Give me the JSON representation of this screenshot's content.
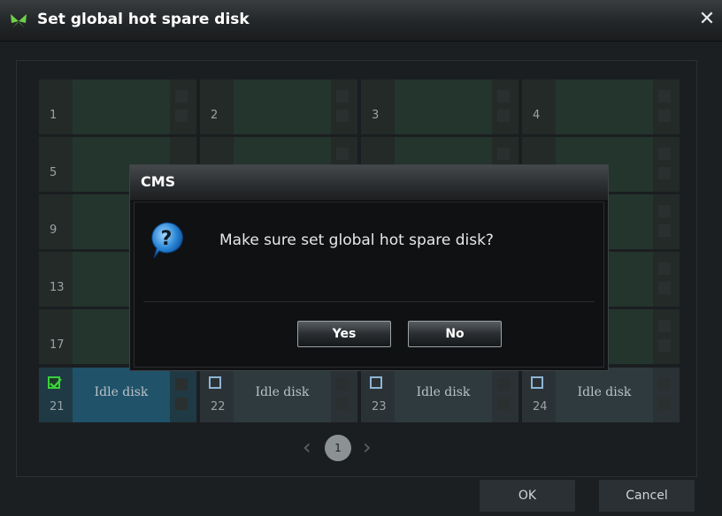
{
  "window": {
    "title": "Set global hot spare disk",
    "close_symbol": "✕"
  },
  "slots": [
    {
      "num": "1"
    },
    {
      "num": "2"
    },
    {
      "num": "3"
    },
    {
      "num": "4"
    },
    {
      "num": "5"
    },
    {
      "num": "9"
    },
    {
      "num": "13"
    },
    {
      "num": "17"
    }
  ],
  "idle_slots": [
    {
      "num": "21",
      "label": "Idle disk",
      "checked": true
    },
    {
      "num": "22",
      "label": "Idle disk",
      "checked": false
    },
    {
      "num": "23",
      "label": "Idle disk",
      "checked": false
    },
    {
      "num": "24",
      "label": "Idle disk",
      "checked": false
    }
  ],
  "pager": {
    "prev": "‹",
    "current": "1",
    "next": "›"
  },
  "buttons": {
    "ok": "OK",
    "cancel": "Cancel"
  },
  "dialog": {
    "title": "CMS",
    "message": "Make sure set global hot spare disk?",
    "yes": "Yes",
    "no": "No",
    "icon": "question-icon"
  },
  "colors": {
    "checked": "#3ad13a",
    "selected_slot": "#20526a",
    "empty_slot": "#24352d"
  }
}
